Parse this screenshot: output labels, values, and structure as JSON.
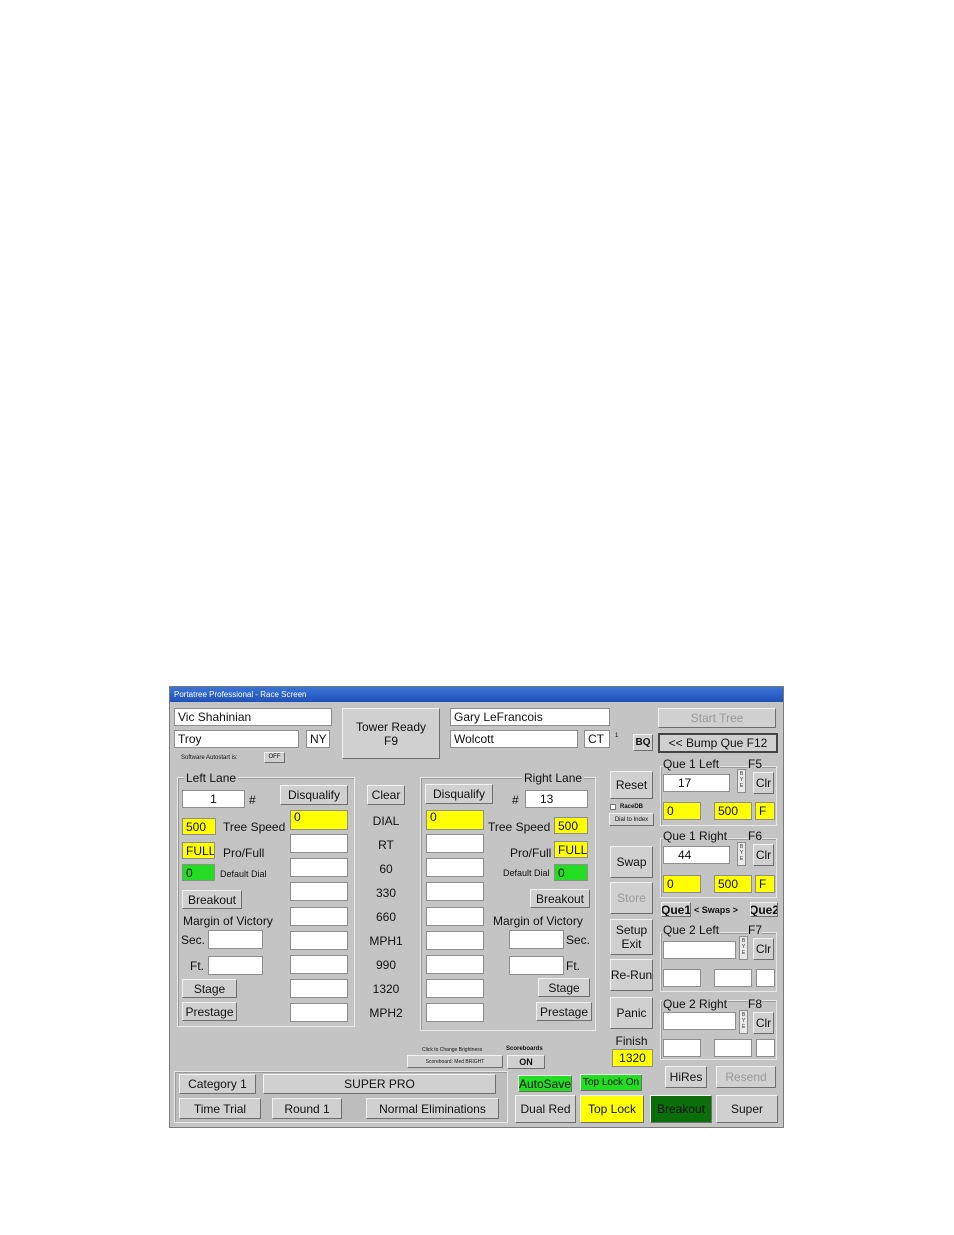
{
  "window": {
    "title": "Portatree Professional - Race Screen"
  },
  "left": {
    "name": "Vic Shahinian",
    "city": "Troy",
    "state": "NY",
    "autostart_label": "Software Autostart is:",
    "autostart_value": "OFF",
    "lane_label": "Left Lane",
    "car_number": "1",
    "hash": "#",
    "disqualify": "Disqualify",
    "dial_value": "0",
    "tree_speed_value": "500",
    "tree_speed_label": "Tree Speed",
    "pro_full_value": "FULL",
    "pro_full_label": "Pro/Full",
    "default_dial_value": "0",
    "default_dial_label": "Default Dial",
    "breakout": "Breakout",
    "margin_label": "Margin of Victory",
    "sec_label": "Sec.",
    "ft_label": "Ft.",
    "stage": "Stage",
    "prestage": "Prestage"
  },
  "right": {
    "name": "Gary LeFrancois",
    "city": "Wolcott",
    "state": "CT",
    "superscript": "1",
    "lane_label": "Right Lane",
    "car_number": "13",
    "hash": "#",
    "disqualify": "Disqualify",
    "dial_value": "0",
    "tree_speed_value": "500",
    "tree_speed_label": "Tree Speed",
    "pro_full_value": "FULL",
    "pro_full_label": "Pro/Full",
    "default_dial_value": "0",
    "default_dial_label": "Default Dial",
    "breakout": "Breakout",
    "margin_label": "Margin of Victory",
    "sec_label": "Sec.",
    "ft_label": "Ft.",
    "stage": "Stage",
    "prestage": "Prestage"
  },
  "center": {
    "tower_ready_line1": "Tower Ready",
    "tower_ready_line2": "F9",
    "clear": "Clear",
    "rows": [
      "DIAL",
      "RT",
      "60",
      "330",
      "660",
      "MPH1",
      "990",
      "1320",
      "MPH2"
    ],
    "brightness_hint": "Click to Change Brightness",
    "scoreboard_brightness": "Scoreboard: Med BRIGHT",
    "scoreboards_label": "Scoreboards",
    "scoreboards_state": "ON"
  },
  "controls": {
    "bq": "BQ",
    "reset": "Reset",
    "racedb": "RaceDB",
    "dial_to_index": "Dial to Index",
    "swap": "Swap",
    "store": "Store",
    "setup_line1": "Setup",
    "setup_line2": "Exit",
    "rerun": "Re-Run",
    "panic": "Panic",
    "finish_label": "Finish",
    "finish_value": "1320"
  },
  "queue": {
    "start_tree": "Start Tree",
    "bump_que": "<< Bump Que  F12",
    "que1_left": "Que 1 Left",
    "f5": "F5",
    "que1_left_number": "17",
    "que1_left_dial": "0",
    "que1_left_speed": "500",
    "que1_left_mode": "F",
    "que1_right": "Que 1 Right",
    "f6": "F6",
    "que1_right_number": "44",
    "que1_right_dial": "0",
    "que1_right_speed": "500",
    "que1_right_mode": "F",
    "que1_btn": "Que1",
    "swaps_label": "< Swaps >",
    "que2_btn": "Que2",
    "que2_left": "Que 2 Left",
    "f7": "F7",
    "que2_right": "Que 2 Right",
    "f8": "F8",
    "clr": "Clr",
    "bye": "B Y E",
    "hires": "HiRes",
    "resend": "Resend"
  },
  "footer": {
    "category": "Category 1",
    "class_name": "SUPER PRO",
    "time_trial": "Time Trial",
    "round": "Round 1",
    "eliminations": "Normal Eliminations",
    "autosave": "AutoSave",
    "top_lock_on": "Top Lock On",
    "dual_red": "Dual Red",
    "top_lock": "Top Lock",
    "breakout": "Breakout",
    "super": "Super"
  },
  "colors": {
    "yellow": "#ffff00",
    "green": "#22dd22",
    "dark_green": "#0b6e0b",
    "panel": "#c4c4c4"
  }
}
